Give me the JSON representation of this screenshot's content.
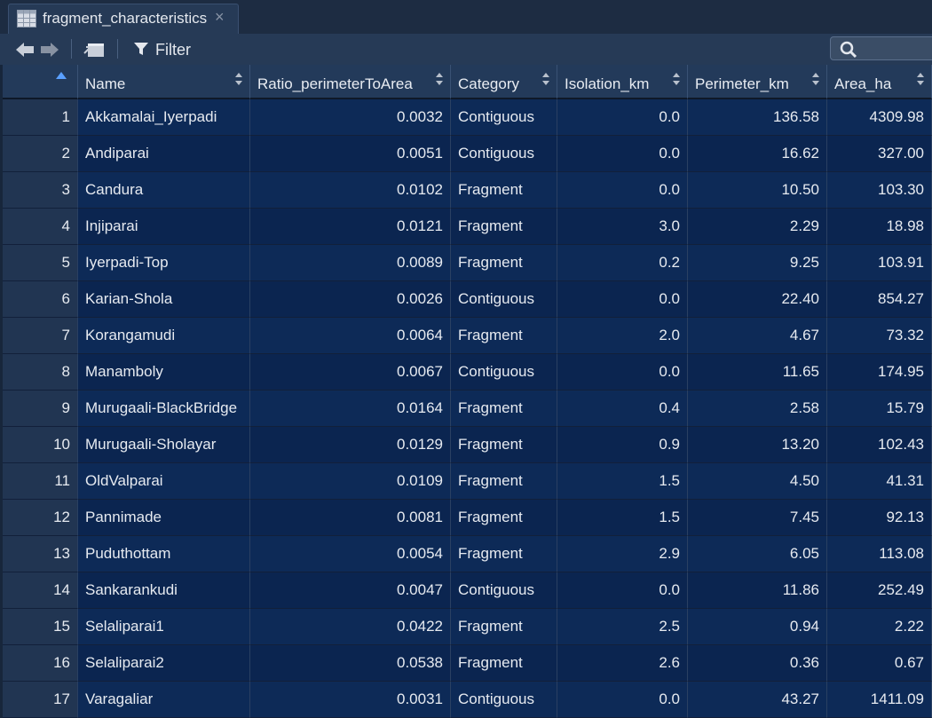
{
  "tab": {
    "title": "fragment_characteristics",
    "close_glyph": "×",
    "icon": "table-grid-icon"
  },
  "toolbar": {
    "filter_label": "Filter",
    "search_placeholder": ""
  },
  "columns": [
    "",
    "Name",
    "Ratio_perimeterToArea",
    "Category",
    "Isolation_km",
    "Perimeter_km",
    "Area_ha"
  ],
  "rows": [
    {
      "n": "1",
      "name": "Akkamalai_Iyerpadi",
      "ratio": "0.0032",
      "category": "Contiguous",
      "isolation": "0.0",
      "perimeter": "136.58",
      "area": "4309.98"
    },
    {
      "n": "2",
      "name": "Andiparai",
      "ratio": "0.0051",
      "category": "Contiguous",
      "isolation": "0.0",
      "perimeter": "16.62",
      "area": "327.00"
    },
    {
      "n": "3",
      "name": "Candura",
      "ratio": "0.0102",
      "category": "Fragment",
      "isolation": "0.0",
      "perimeter": "10.50",
      "area": "103.30"
    },
    {
      "n": "4",
      "name": "Injiparai",
      "ratio": "0.0121",
      "category": "Fragment",
      "isolation": "3.0",
      "perimeter": "2.29",
      "area": "18.98"
    },
    {
      "n": "5",
      "name": "Iyerpadi-Top",
      "ratio": "0.0089",
      "category": "Fragment",
      "isolation": "0.2",
      "perimeter": "9.25",
      "area": "103.91"
    },
    {
      "n": "6",
      "name": "Karian-Shola",
      "ratio": "0.0026",
      "category": "Contiguous",
      "isolation": "0.0",
      "perimeter": "22.40",
      "area": "854.27"
    },
    {
      "n": "7",
      "name": "Korangamudi",
      "ratio": "0.0064",
      "category": "Fragment",
      "isolation": "2.0",
      "perimeter": "4.67",
      "area": "73.32"
    },
    {
      "n": "8",
      "name": "Manamboly",
      "ratio": "0.0067",
      "category": "Contiguous",
      "isolation": "0.0",
      "perimeter": "11.65",
      "area": "174.95"
    },
    {
      "n": "9",
      "name": "Murugaali-BlackBridge",
      "ratio": "0.0164",
      "category": "Fragment",
      "isolation": "0.4",
      "perimeter": "2.58",
      "area": "15.79"
    },
    {
      "n": "10",
      "name": "Murugaali-Sholayar",
      "ratio": "0.0129",
      "category": "Fragment",
      "isolation": "0.9",
      "perimeter": "13.20",
      "area": "102.43"
    },
    {
      "n": "11",
      "name": "OldValparai",
      "ratio": "0.0109",
      "category": "Fragment",
      "isolation": "1.5",
      "perimeter": "4.50",
      "area": "41.31"
    },
    {
      "n": "12",
      "name": "Pannimade",
      "ratio": "0.0081",
      "category": "Fragment",
      "isolation": "1.5",
      "perimeter": "7.45",
      "area": "92.13"
    },
    {
      "n": "13",
      "name": "Puduthottam",
      "ratio": "0.0054",
      "category": "Fragment",
      "isolation": "2.9",
      "perimeter": "6.05",
      "area": "113.08"
    },
    {
      "n": "14",
      "name": "Sankarankudi",
      "ratio": "0.0047",
      "category": "Contiguous",
      "isolation": "0.0",
      "perimeter": "11.86",
      "area": "252.49"
    },
    {
      "n": "15",
      "name": "Selaliparai1",
      "ratio": "0.0422",
      "category": "Fragment",
      "isolation": "2.5",
      "perimeter": "0.94",
      "area": "2.22"
    },
    {
      "n": "16",
      "name": "Selaliparai2",
      "ratio": "0.0538",
      "category": "Fragment",
      "isolation": "2.6",
      "perimeter": "0.36",
      "area": "0.67"
    },
    {
      "n": "17",
      "name": "Varagaliar",
      "ratio": "0.0031",
      "category": "Contiguous",
      "isolation": "0.0",
      "perimeter": "43.27",
      "area": "1411.09"
    }
  ]
}
